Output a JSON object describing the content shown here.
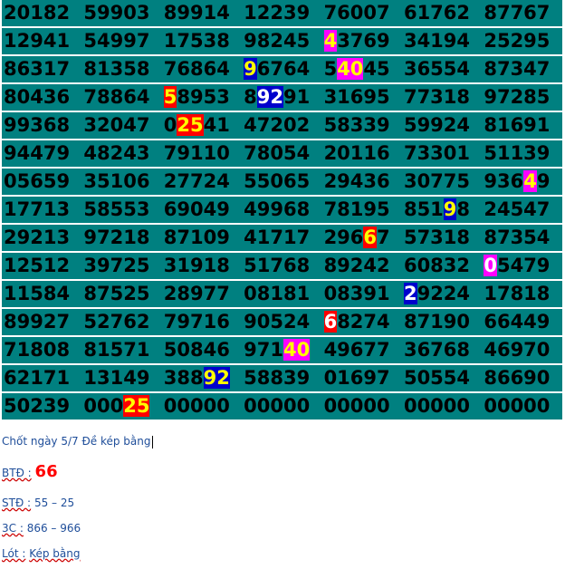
{
  "rows": [
    [
      "20182",
      "59903",
      "89914",
      "12239",
      "76007",
      "61762",
      "87767"
    ],
    [
      "12941",
      "54997",
      "17538",
      "98245",
      [
        [
          "4",
          "magenta",
          "#ffff00"
        ],
        [
          "3769"
        ]
      ],
      "34194",
      "25295"
    ],
    [
      "86317",
      "81358",
      "76864",
      [
        [
          "9",
          "blue",
          "#ffff00"
        ],
        [
          "6764"
        ]
      ],
      [
        [
          "5"
        ],
        [
          "40",
          "magenta",
          "#ffff00"
        ],
        [
          "45"
        ]
      ],
      "36554",
      "87347"
    ],
    [
      "80436",
      "78864",
      [
        [
          "5",
          "red",
          "#ffff00"
        ],
        [
          "8953"
        ]
      ],
      [
        [
          "8"
        ],
        [
          "92",
          "blue",
          "#ffffff"
        ],
        [
          "91"
        ]
      ],
      "31695",
      "77318",
      "97285"
    ],
    [
      "99368",
      "32047",
      [
        [
          "0"
        ],
        [
          "25",
          "red",
          "#ffff00"
        ],
        [
          "41"
        ]
      ],
      "47202",
      "58339",
      "59924",
      "81691"
    ],
    [
      "94479",
      "48243",
      "79110",
      "78054",
      "20116",
      "73301",
      "51139"
    ],
    [
      "05659",
      "35106",
      "27724",
      "55065",
      "29436",
      "30775",
      [
        [
          "936"
        ],
        [
          "4",
          "magenta",
          "#ffff00"
        ],
        [
          "9"
        ]
      ]
    ],
    [
      "17713",
      "58553",
      "69049",
      "49968",
      "78195",
      [
        [
          "851"
        ],
        [
          "9",
          "blue",
          "#ffff00"
        ],
        [
          "8"
        ]
      ],
      "24547"
    ],
    [
      "29213",
      "97218",
      "87109",
      "41717",
      [
        [
          "296"
        ],
        [
          "6",
          "red",
          "#ffff00"
        ],
        [
          "7"
        ]
      ],
      "57318",
      "87354"
    ],
    [
      "12512",
      "39725",
      "31918",
      "51768",
      "89242",
      "60832",
      [
        [
          "0",
          "magenta",
          "#ffffff"
        ],
        [
          "5479"
        ]
      ]
    ],
    [
      "11584",
      "87525",
      "28977",
      "08181",
      "08391",
      [
        [
          "2",
          "blue",
          "#ffffff"
        ],
        [
          "9224"
        ]
      ],
      "17818"
    ],
    [
      "89927",
      "52762",
      "79716",
      "90524",
      [
        [
          "6",
          "red",
          "#ffffff"
        ],
        [
          "8274"
        ]
      ],
      "87190",
      "66449"
    ],
    [
      "71808",
      "81571",
      "50846",
      [
        [
          "971"
        ],
        [
          "40",
          "magenta",
          "#ffff00"
        ]
      ],
      "49677",
      "36768",
      "46970"
    ],
    [
      "62171",
      "13149",
      [
        [
          "388"
        ],
        [
          "92",
          "blue",
          "#ffff00"
        ]
      ],
      "58839",
      "01697",
      "50554",
      "86690"
    ],
    [
      "50239",
      [
        [
          "000"
        ],
        [
          "25",
          "red",
          "#ffff00"
        ]
      ],
      "00000",
      "00000",
      "00000",
      "00000",
      "00000"
    ]
  ],
  "notes": {
    "title": "Chốt ngày 5/7 Đề kép bằng",
    "btd_label": "BTĐ :",
    "btd_value": "66",
    "std_label": "STĐ :",
    "std_value": "55 – 25",
    "bc_label": "3C :",
    "bc_value": "866  – 966",
    "lot_label": "Lót :",
    "lot_value": "Kép bằng"
  },
  "colors": {
    "teal": "#008080",
    "red": "#ff0000",
    "blue": "#0000cc",
    "magenta": "#ff00ff",
    "note_text": "#1f4e9a"
  }
}
